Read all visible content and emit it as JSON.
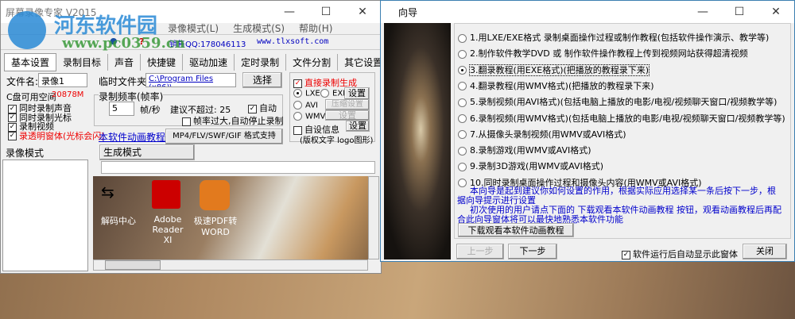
{
  "main_window": {
    "title": "屏幕录像专家 V2015",
    "menu": [
      "录像模式(L)",
      "生成模式(S)",
      "帮助(H)"
    ],
    "sales_qq": "销售QQ:178046113",
    "website": "www.tlxsoft.com",
    "tabs": [
      "基本设置",
      "录制目标",
      "声音",
      "快捷键",
      "驱动加速",
      "定时录制",
      "文件分割",
      "其它设置"
    ],
    "filename_label": "文件名:",
    "filename_value": "录像1",
    "temp_label": "临时文件夹:",
    "temp_value": "C:\\Program Files (x86)\\",
    "select_btn": "选择",
    "disk_label": "C盘可用空间",
    "disk_value": "20878M",
    "checks": [
      "同时录制声音",
      "同时录制光标",
      "录制视频",
      "录透明窗体(光标会闪)"
    ],
    "fps_group": "录制频率(帧率)",
    "fps_value": "5",
    "fps_unit": "帧/秒",
    "fps_hint": "建议不超过: 25",
    "auto_label": "自动",
    "fps_stop": "帧率过大,自动停止录制",
    "tutorial_link": "本软件动画教程",
    "format_btn": "MP4/FLV/SWF/GIF  格式支持",
    "direct_gen": "直接录制生成",
    "fmt_lxe": "LXE",
    "fmt_exe": "EXE",
    "fmt_avi": "AVI",
    "fmt_wmv": "WMV",
    "set_btn": "设置",
    "compress_btn": "压缩设置",
    "custom_info": "自设信息",
    "custom_note": "(版权文字 logo图形)",
    "rec_mode": "录像模式",
    "gen_mode": "生成模式",
    "desktop_icons": [
      "解码中心",
      "Adobe Reader XI",
      "极速PDF转 WORD"
    ]
  },
  "wizard": {
    "title": "向导",
    "options": [
      "1.用LXE/EXE格式 录制桌面操作过程或制作教程(包括软件操作演示、教学等)",
      "2.制作软件教学DVD 或 制作软件操作教程上传到视频网站获得超清视频",
      "3.翻录教程(用EXE格式)(把播放的教程录下来)",
      "4.翻录教程(用WMV格式)(把播放的教程录下来)",
      "5.录制视频(用AVI格式)(包括电脑上播放的电影/电视/视频聊天窗口/视频教学等)",
      "6.录制视频(用WMV格式)(包括电脑上播放的电影/电视/视频聊天窗口/视频教学等)",
      "7.从摄像头录制视频(用WMV或AVI格式)",
      "8.录制游戏(用WMV或AVI格式)",
      "9.录制3D游戏(用WMV或AVI格式)",
      "10.同时录制桌面操作过程和摄像头内容(用WMV或AVI格式)"
    ],
    "selected": 3,
    "hint1": "本向导是起到建议你如何设置的作用，根据实际应用选择某一条后按下一步，根据向导提示进行设置",
    "hint2": "初次使用的用户请点下面的 下载观看本软件动画教程 按钮，观看动画教程后再配合此向导窗体将可以最快地熟悉本软件功能",
    "download_btn": "下载观看本软件动画教程",
    "prev_btn": "上一步",
    "next_btn": "下一步",
    "auto_show": "软件运行后自动显示此窗体",
    "close_btn": "关闭"
  },
  "watermark": {
    "name": "河东软件园",
    "url": "www.pc0359.cn"
  }
}
